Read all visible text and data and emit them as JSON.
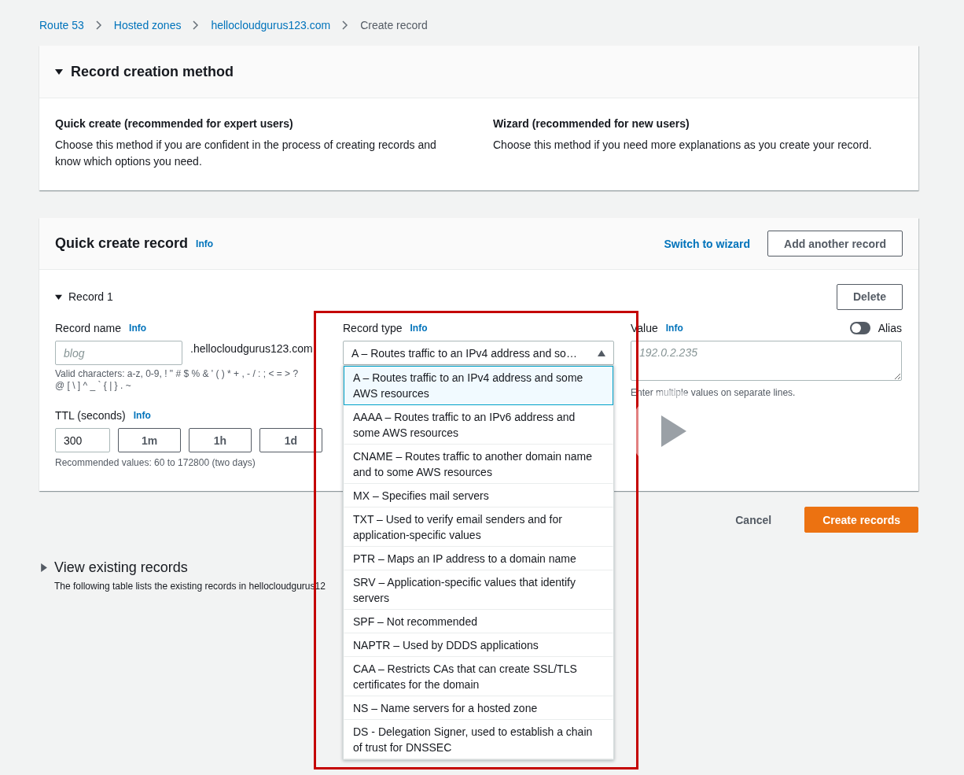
{
  "breadcrumb": [
    {
      "label": "Route 53",
      "current": false
    },
    {
      "label": "Hosted zones",
      "current": false
    },
    {
      "label": "hellocloudgurus123.com",
      "current": false
    },
    {
      "label": "Create record",
      "current": true
    }
  ],
  "method_panel": {
    "title": "Record creation method",
    "expanded": true,
    "options": [
      {
        "title": "Quick create (recommended for expert users)",
        "description": "Choose this method if you are confident in the process of creating records and know which options you need."
      },
      {
        "title": "Wizard (recommended for new users)",
        "description": "Choose this method if you need more explanations as you create your record."
      }
    ]
  },
  "quick_create": {
    "title": "Quick create record",
    "info": "Info",
    "switch_link": "Switch to wizard",
    "add_button": "Add another record",
    "record": {
      "title": "Record 1",
      "expanded": true,
      "delete_button": "Delete",
      "name_field": {
        "label": "Record name",
        "info": "Info",
        "placeholder": "blog",
        "suffix": ".hellocloudgurus123.com",
        "hint": "Valid characters: a-z, 0-9, ! \" # $ % & ' ( ) * + , - / : ; < = > ? @ [ \\ ] ^ _ ` { | } . ~"
      },
      "ttl": {
        "label": "TTL (seconds)",
        "info": "Info",
        "value": "300",
        "presets": [
          "1m",
          "1h",
          "1d"
        ],
        "hint": "Recommended values: 60 to 172800 (two days)"
      },
      "type_field": {
        "label": "Record type",
        "info": "Info",
        "value": "A – Routes traffic to an IPv4 address and so…",
        "open": true,
        "options": [
          {
            "label": "A – Routes traffic to an IPv4 address and some AWS resources",
            "selected": true
          },
          {
            "label": "AAAA – Routes traffic to an IPv6 address and some AWS resources",
            "selected": false
          },
          {
            "label": "CNAME – Routes traffic to another domain name and to some AWS resources",
            "selected": false
          },
          {
            "label": "MX – Specifies mail servers",
            "selected": false
          },
          {
            "label": "TXT – Used to verify email senders and for application-specific values",
            "selected": false
          },
          {
            "label": "PTR – Maps an IP address to a domain name",
            "selected": false
          },
          {
            "label": "SRV – Application-specific values that identify servers",
            "selected": false
          },
          {
            "label": "SPF – Not recommended",
            "selected": false
          },
          {
            "label": "NAPTR – Used by DDDS applications",
            "selected": false
          },
          {
            "label": "CAA – Restricts CAs that can create SSL/TLS certificates for the domain",
            "selected": false
          },
          {
            "label": "NS – Name servers for a hosted zone",
            "selected": false
          },
          {
            "label": "DS - Delegation Signer, used to establish a chain of trust for DNSSEC",
            "selected": false
          }
        ]
      },
      "value_field": {
        "label": "Value",
        "info": "Info",
        "placeholder": "192.0.2.235",
        "hint": "Enter multiple values on separate lines.",
        "alias": {
          "label": "Alias",
          "on": false
        }
      }
    }
  },
  "actions": {
    "cancel": "Cancel",
    "create": "Create records"
  },
  "existing": {
    "title": "View existing records",
    "expanded": false,
    "description": "The following table lists the existing records in hellocloudgurus12"
  }
}
